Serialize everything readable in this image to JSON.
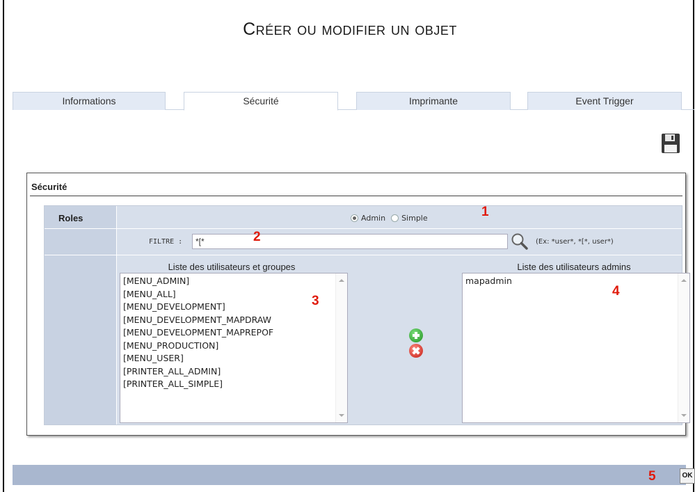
{
  "window": {
    "title": "Créer ou modifier un objet"
  },
  "tabs": [
    {
      "label": "Informations",
      "active": false
    },
    {
      "label": "Sécurité",
      "active": true
    },
    {
      "label": "Imprimante",
      "active": false
    },
    {
      "label": "Event Trigger",
      "active": false
    }
  ],
  "toolbar": {
    "save_icon": "floppy-disk-icon"
  },
  "security": {
    "section_title": "Sécurité",
    "roles_label": "Roles",
    "role_options": [
      {
        "label": "Admin",
        "selected": true
      },
      {
        "label": "Simple",
        "selected": false
      }
    ],
    "filter": {
      "label": "FILTRE :",
      "value": "*[*",
      "hint": "(Ex: *user*, *[*, user*)"
    },
    "available_list": {
      "title": "Liste des utilisateurs et groupes",
      "items": [
        "[MENU_ADMIN]",
        "[MENU_ALL]",
        "[MENU_DEVELOPMENT]",
        "[MENU_DEVELOPMENT_MAPDRAW",
        "[MENU_DEVELOPMENT_MAPREPOF",
        "[MENU_PRODUCTION]",
        "[MENU_USER]",
        "[PRINTER_ALL_ADMIN]",
        "[PRINTER_ALL_SIMPLE]"
      ]
    },
    "admin_list": {
      "title": "Liste des utilisateurs admins",
      "items": [
        "mapadmin"
      ]
    },
    "add_icon": "plus-circle-icon",
    "remove_icon": "x-circle-icon"
  },
  "callouts": [
    "1",
    "2",
    "3",
    "4",
    "5"
  ],
  "footer": {
    "ok_label": "OK"
  },
  "colors": {
    "callout": "#e01b0c",
    "grid_bg": "#d7dfeb",
    "footer_bg": "#a9b7cf",
    "tab_bg": "#e3eaf5"
  }
}
